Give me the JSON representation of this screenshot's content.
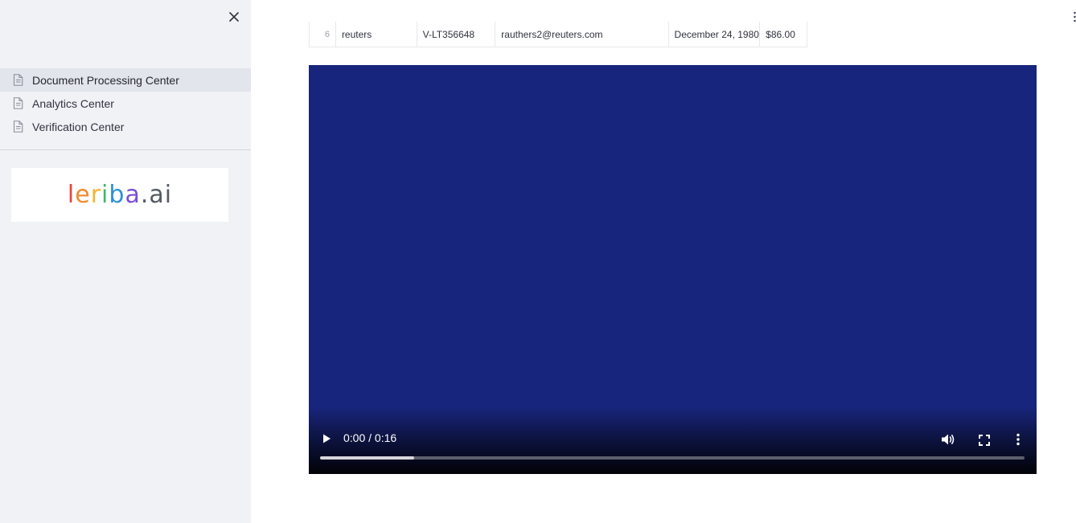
{
  "sidebar": {
    "close_icon": "close-icon",
    "nav_items": [
      {
        "label": "Document Processing Center",
        "icon": "document-icon",
        "active": true
      },
      {
        "label": "Analytics Center",
        "icon": "document-icon",
        "active": false
      },
      {
        "label": "Verification Center",
        "icon": "document-icon",
        "active": false
      }
    ],
    "logo": {
      "text": "leriba.ai",
      "letters": [
        {
          "ch": "l",
          "color": "#e8453c"
        },
        {
          "ch": "e",
          "color": "#f08a2c"
        },
        {
          "ch": "r",
          "color": "#f2b631"
        },
        {
          "ch": "i",
          "color": "#3eb86a"
        },
        {
          "ch": "b",
          "color": "#2f8fd6"
        },
        {
          "ch": "a",
          "color": "#7a4fd0"
        },
        {
          "ch": ".",
          "color": "#555a64"
        },
        {
          "ch": "a",
          "color": "#555a64"
        },
        {
          "ch": "i",
          "color": "#555a64"
        }
      ]
    }
  },
  "table": {
    "row": {
      "index": "6",
      "name": "reuters",
      "code": "V-LT356648",
      "email": "rauthers2@reuters.com",
      "date": "December 24, 1980",
      "amount": "$86.00"
    }
  },
  "video": {
    "time": "0:00 / 0:16",
    "background": "#18257c",
    "progress_buffered": 0.133,
    "controls": [
      "play-icon",
      "volume-icon",
      "fullscreen-icon",
      "more-options-icon"
    ]
  },
  "main": {
    "menu_icon": "kebab-menu-icon"
  }
}
